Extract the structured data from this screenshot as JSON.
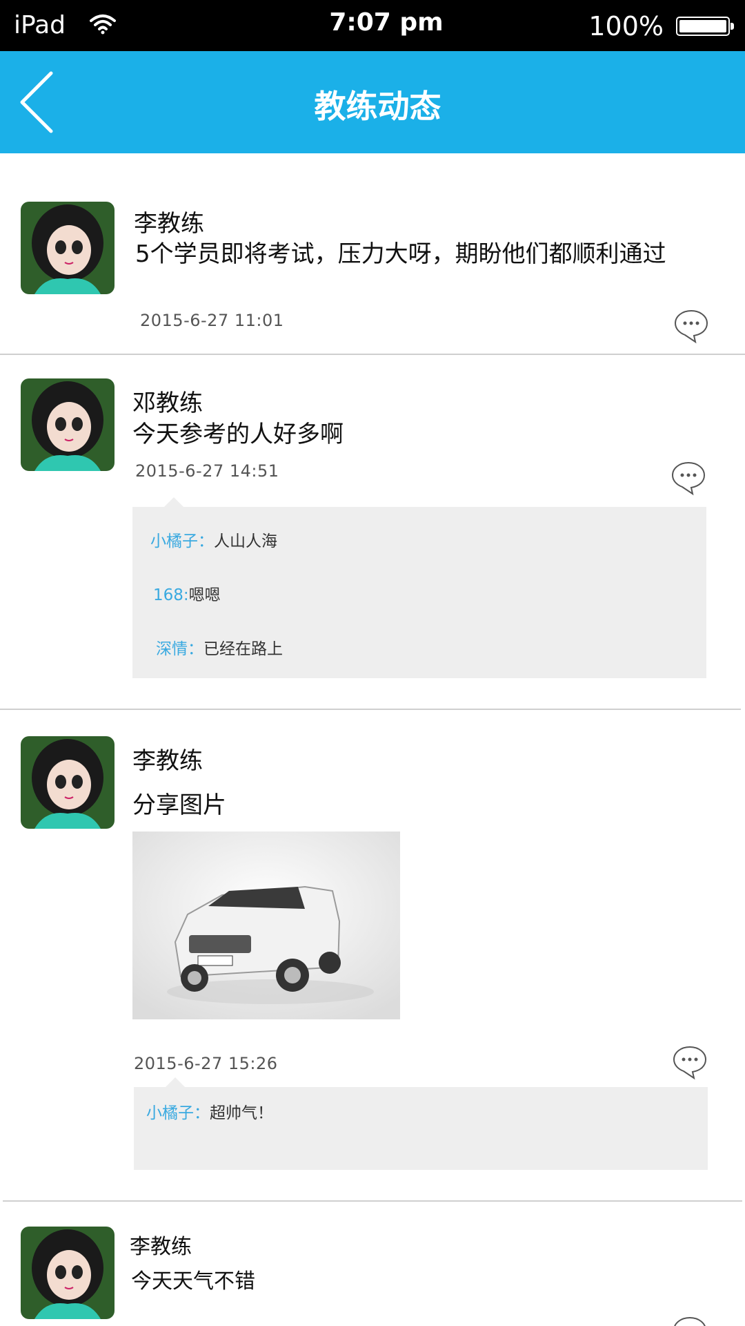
{
  "status_bar": {
    "carrier": "iPad",
    "time": "7:07 pm",
    "battery": "100%"
  },
  "nav": {
    "title": "教练动态"
  },
  "posts": [
    {
      "author": "李教练",
      "content": "5个学员即将考试，压力大呀，期盼他们都顺利通过",
      "time": "2015-6-27  11:01",
      "comments": []
    },
    {
      "author": "邓教练",
      "content": "今天参考的人好多啊",
      "time": "2015-6-27  14:51",
      "comments": [
        {
          "name": "小橘子：",
          "text": "人山人海"
        },
        {
          "name": "168:",
          "text": "嗯嗯"
        },
        {
          "name": "深情：",
          "text": "已经在路上"
        }
      ]
    },
    {
      "author": "李教练",
      "content": "分享图片",
      "time": "2015-6-27  15:26",
      "comments": [
        {
          "name": "小橘子：",
          "text": "超帅气！"
        }
      ]
    },
    {
      "author": "李教练",
      "content": "今天天气不错",
      "time": "",
      "comments": []
    }
  ],
  "icons": {
    "back": "chevron-left-icon",
    "wifi": "wifi-icon",
    "battery": "battery-icon",
    "comment": "speech-bubble-icon"
  },
  "colors": {
    "nav_bg": "#1bb0e8",
    "commenter_name": "#39a9e0",
    "comment_bg": "#eeeeee"
  }
}
